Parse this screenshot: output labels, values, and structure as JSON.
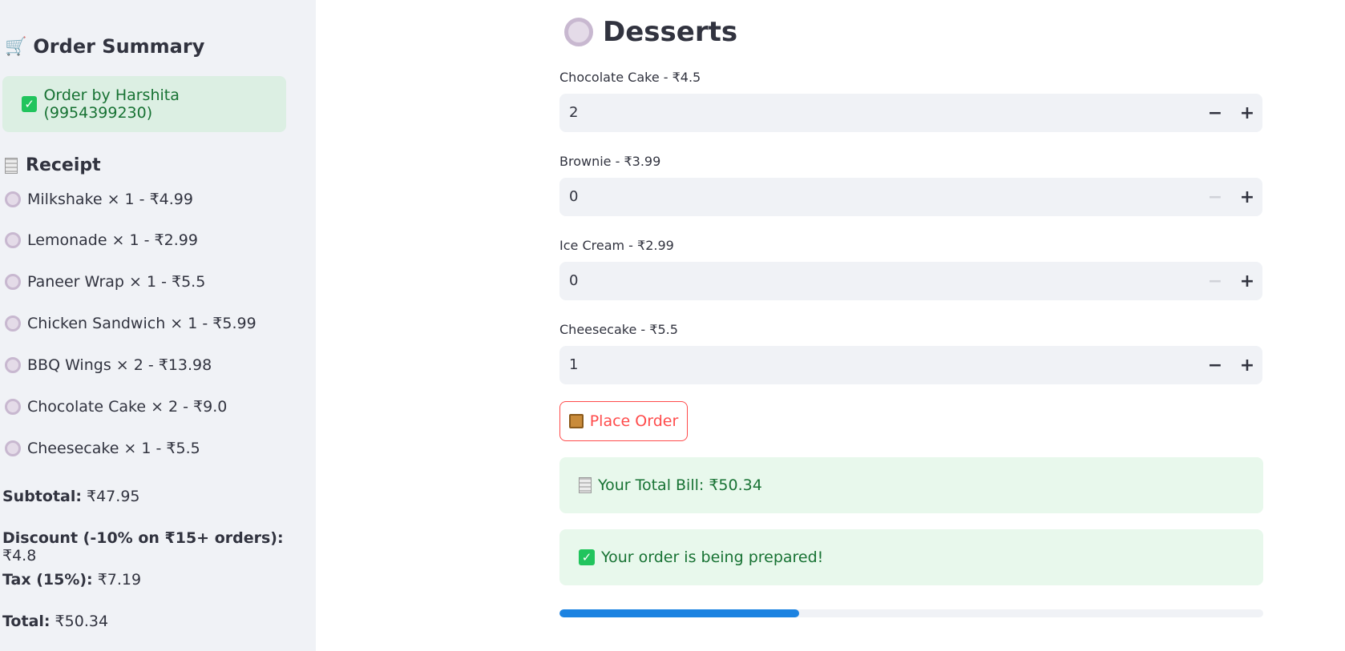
{
  "sidebar": {
    "title": "Order Summary",
    "alert": "Order by Harshita (9954399230)",
    "receipt_title": "Receipt",
    "lines": [
      "Milkshake × 1 - ₹4.99",
      "Lemonade × 1 - ₹2.99",
      "Paneer Wrap × 1 - ₹5.5",
      "Chicken Sandwich × 1 - ₹5.99",
      "BBQ Wings × 2 - ₹13.98",
      "Chocolate Cake × 2 - ₹9.0",
      "Cheesecake × 1 - ₹5.5"
    ],
    "subtotal_label": "Subtotal:",
    "subtotal_value": " ₹47.95",
    "discount_label": "Discount (-10% on ₹15+ orders):",
    "discount_value": " ₹4.8",
    "tax_label": "Tax (15%):",
    "tax_value": " ₹7.19",
    "total_label": "Total:",
    "total_value": " ₹50.34"
  },
  "main": {
    "title": "Desserts",
    "items": [
      {
        "label": "Chocolate Cake - ₹4.5",
        "value": "2",
        "minus_disabled": false
      },
      {
        "label": "Brownie - ₹3.99",
        "value": "0",
        "minus_disabled": true
      },
      {
        "label": "Ice Cream - ₹2.99",
        "value": "0",
        "minus_disabled": true
      },
      {
        "label": "Cheesecake - ₹5.5",
        "value": "1",
        "minus_disabled": false
      }
    ],
    "place_order_label": "Place Order",
    "total_bill": "Your Total Bill: ₹50.34",
    "status_message": "Your order is being prepared!",
    "progress_fraction": 0.34
  },
  "icons": {
    "cart": "shopping-cart-icon",
    "check": "check-icon",
    "receipt": "receipt-icon",
    "plate": "plate-icon",
    "box": "package-icon"
  },
  "colors": {
    "accent": "#ff4b4b",
    "success_text": "#177233",
    "success_bg": "#e8f8ec",
    "progress": "#1c83e1",
    "sidebar_bg": "#f0f2f6"
  }
}
